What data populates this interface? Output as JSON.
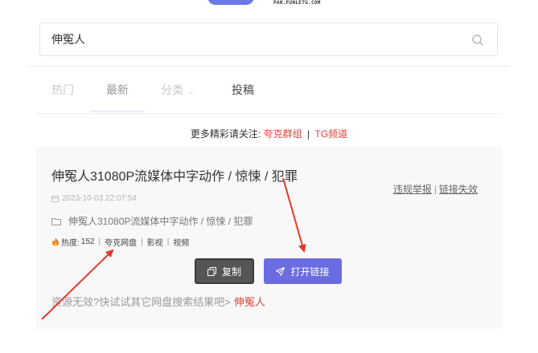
{
  "brand": {
    "domain_text": "PAN.FUNLETU.COM"
  },
  "search": {
    "value": "伸冤人"
  },
  "tabs": [
    {
      "label": "热门"
    },
    {
      "label": "最新"
    },
    {
      "label": "分类"
    },
    {
      "label": "投稿"
    }
  ],
  "follow": {
    "prefix": "更多精彩请关注:",
    "link1": "夸克群组",
    "sep": "|",
    "link2": "TG频道"
  },
  "result": {
    "title": "伸冤人31080P流媒体中字动作 / 惊悚 / 犯罪",
    "date": "2023-10-03 22:07:54",
    "report_label": "违规举报",
    "report_sep": "|",
    "invalid_label": "链接失效",
    "folder_name": "伸冤人31080P流媒体中字动作 / 惊悚 / 犯罪",
    "heat_label": "热度:",
    "heat_value": "152",
    "tag1": "夸克网盘",
    "tag2": "影视",
    "tag3": "视频",
    "copy_label": "复制",
    "open_label": "打开链接",
    "fail_text": "资源无效?快试试其它网盘搜索结果吧>",
    "fail_keyword": "伸冤人"
  },
  "colors": {
    "accent": "#6b6ce0",
    "link_red": "#e0443c",
    "arrow_red": "#e8382f"
  }
}
